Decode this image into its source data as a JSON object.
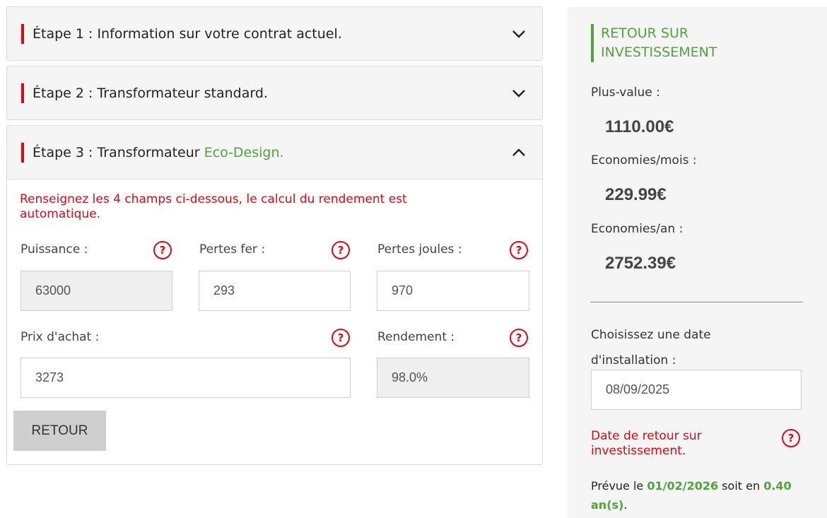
{
  "steps": [
    {
      "label": "Étape 1 : Information sur votre contrat actuel.",
      "expanded": false
    },
    {
      "label": "Étape 2 : Transformateur standard.",
      "expanded": false
    },
    {
      "label_prefix": "Étape 3 : Transformateur ",
      "label_highlight": "Eco-Design.",
      "expanded": true
    }
  ],
  "step3": {
    "intro": "Renseignez les 4 champs ci-dessous, le calcul du rendement est automatique.",
    "fields": {
      "puissance": {
        "label": "Puissance :",
        "value": "63000",
        "readonly": true
      },
      "pertes_fer": {
        "label": "Pertes fer :",
        "value": "293"
      },
      "pertes_joules": {
        "label": "Pertes joules :",
        "value": "970"
      },
      "prix_achat": {
        "label": "Prix d'achat :",
        "value": "3273"
      },
      "rendement": {
        "label": "Rendement :",
        "value": "98.0%",
        "readonly": true
      }
    },
    "help_symbol": "?",
    "back_button": "RETOUR"
  },
  "sidebar": {
    "title": "RETOUR SUR INVESTISSEMENT",
    "plus_value_label": "Plus-value :",
    "plus_value": "1110.00€",
    "eco_mois_label": "Economies/mois :",
    "eco_mois": "229.99€",
    "eco_an_label": "Economies/an :",
    "eco_an": "2752.39€",
    "choose_date_label": "Choisissez une date d'installation :",
    "install_date": "08/09/2025",
    "roi_label": "Date de retour sur investissement.",
    "pred_prefix": "Prévue le ",
    "pred_date": "01/02/2026",
    "pred_mid": " soit en ",
    "pred_years": "0.40 an(s)",
    "pred_suffix": "."
  },
  "colors": {
    "accent_red": "#e30613",
    "accent_green": "#4fa53a"
  }
}
